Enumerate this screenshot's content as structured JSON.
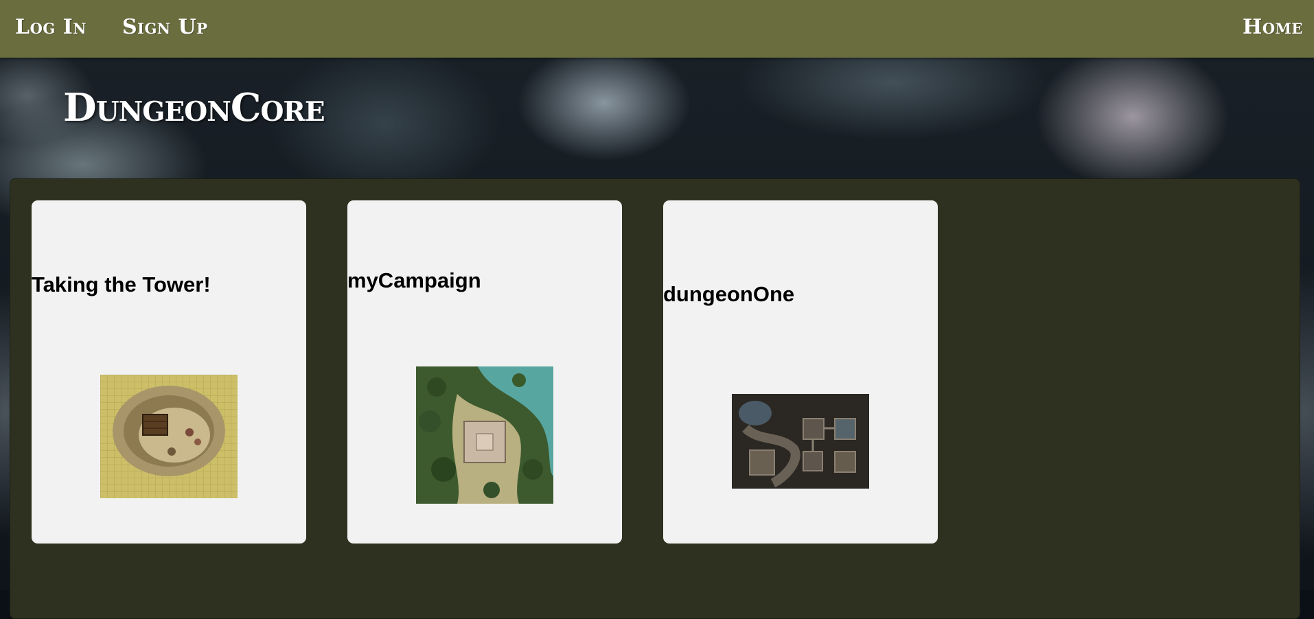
{
  "nav": {
    "login_label": "Log In",
    "signup_label": "Sign Up",
    "home_label": "Home"
  },
  "header": {
    "brand": "DungeonCore"
  },
  "campaigns": [
    {
      "title": "Taking the Tower!",
      "map_icon": "desert-tower-map-image"
    },
    {
      "title": "myCampaign",
      "map_icon": "forest-ruins-map-image"
    },
    {
      "title": "dungeonOne",
      "map_icon": "dungeon-rooms-map-image"
    }
  ],
  "colors": {
    "navbar": "#6a6e3f",
    "panel": "#2e311f",
    "card": "#f2f2f2"
  }
}
